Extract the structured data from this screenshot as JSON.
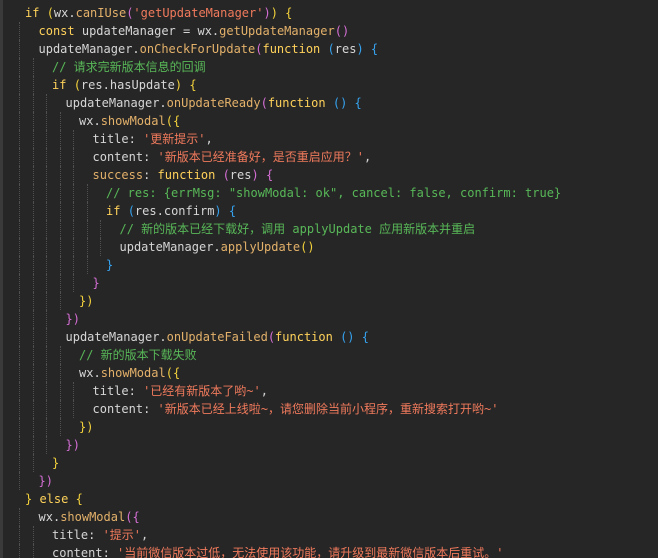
{
  "editor": {
    "language": "javascript",
    "lines": [
      [
        {
          "t": "if ",
          "c": "kw"
        },
        {
          "t": "(",
          "c": "p1"
        },
        {
          "t": "wx",
          "c": "id"
        },
        {
          "t": ".",
          "c": "op"
        },
        {
          "t": "canIUse",
          "c": "fn"
        },
        {
          "t": "(",
          "c": "p2"
        },
        {
          "t": "'getUpdateManager'",
          "c": "str"
        },
        {
          "t": ")",
          "c": "p2"
        },
        {
          "t": ")",
          "c": "p1"
        },
        {
          "t": " {",
          "c": "p1"
        }
      ],
      [
        {
          "t": "const ",
          "c": "kw"
        },
        {
          "t": "updateManager ",
          "c": "id"
        },
        {
          "t": "= ",
          "c": "op"
        },
        {
          "t": "wx",
          "c": "id"
        },
        {
          "t": ".",
          "c": "op"
        },
        {
          "t": "getUpdateManager",
          "c": "fn"
        },
        {
          "t": "()",
          "c": "p2"
        }
      ],
      [
        {
          "t": "updateManager",
          "c": "id"
        },
        {
          "t": ".",
          "c": "op"
        },
        {
          "t": "onCheckForUpdate",
          "c": "fn"
        },
        {
          "t": "(",
          "c": "p2"
        },
        {
          "t": "function ",
          "c": "kw"
        },
        {
          "t": "(",
          "c": "p3"
        },
        {
          "t": "res",
          "c": "id"
        },
        {
          "t": ")",
          "c": "p3"
        },
        {
          "t": " {",
          "c": "p3"
        }
      ],
      [
        {
          "t": "// 请求完新版本信息的回调",
          "c": "cm"
        }
      ],
      [
        {
          "t": "if ",
          "c": "kw"
        },
        {
          "t": "(",
          "c": "p1"
        },
        {
          "t": "res",
          "c": "id"
        },
        {
          "t": ".",
          "c": "op"
        },
        {
          "t": "hasUpdate",
          "c": "pr"
        },
        {
          "t": ")",
          "c": "p1"
        },
        {
          "t": " {",
          "c": "p1"
        }
      ],
      [
        {
          "t": "updateManager",
          "c": "id"
        },
        {
          "t": ".",
          "c": "op"
        },
        {
          "t": "onUpdateReady",
          "c": "fn"
        },
        {
          "t": "(",
          "c": "p2"
        },
        {
          "t": "function ",
          "c": "kw"
        },
        {
          "t": "()",
          "c": "p3"
        },
        {
          "t": " {",
          "c": "p3"
        }
      ],
      [
        {
          "t": "wx",
          "c": "id"
        },
        {
          "t": ".",
          "c": "op"
        },
        {
          "t": "showModal",
          "c": "fn"
        },
        {
          "t": "({",
          "c": "p1"
        }
      ],
      [
        {
          "t": "title",
          "c": "pr"
        },
        {
          "t": ": ",
          "c": "op"
        },
        {
          "t": "'更新提示'",
          "c": "str"
        },
        {
          "t": ",",
          "c": "op"
        }
      ],
      [
        {
          "t": "content",
          "c": "pr"
        },
        {
          "t": ": ",
          "c": "op"
        },
        {
          "t": "'新版本已经准备好，是否重启应用？'",
          "c": "str"
        },
        {
          "t": ",",
          "c": "op"
        }
      ],
      [
        {
          "t": "success",
          "c": "fn"
        },
        {
          "t": ": ",
          "c": "op"
        },
        {
          "t": "function ",
          "c": "kw"
        },
        {
          "t": "(",
          "c": "p2"
        },
        {
          "t": "res",
          "c": "id"
        },
        {
          "t": ")",
          "c": "p2"
        },
        {
          "t": " {",
          "c": "p2"
        }
      ],
      [
        {
          "t": "// res: {errMsg: \"showModal: ok\", cancel: false, confirm: true}",
          "c": "cm"
        }
      ],
      [
        {
          "t": "if ",
          "c": "kw"
        },
        {
          "t": "(",
          "c": "p3"
        },
        {
          "t": "res",
          "c": "id"
        },
        {
          "t": ".",
          "c": "op"
        },
        {
          "t": "confirm",
          "c": "pr"
        },
        {
          "t": ")",
          "c": "p3"
        },
        {
          "t": " {",
          "c": "p3"
        }
      ],
      [
        {
          "t": "// 新的版本已经下载好，调用 applyUpdate 应用新版本并重启",
          "c": "cm"
        }
      ],
      [
        {
          "t": "updateManager",
          "c": "id"
        },
        {
          "t": ".",
          "c": "op"
        },
        {
          "t": "applyUpdate",
          "c": "fn"
        },
        {
          "t": "()",
          "c": "p1"
        }
      ],
      [
        {
          "t": "}",
          "c": "p3"
        }
      ],
      [
        {
          "t": "}",
          "c": "p2"
        }
      ],
      [
        {
          "t": "})",
          "c": "p1"
        }
      ],
      [
        {
          "t": "})",
          "c": "p2"
        }
      ],
      [
        {
          "t": "updateManager",
          "c": "id"
        },
        {
          "t": ".",
          "c": "op"
        },
        {
          "t": "onUpdateFailed",
          "c": "fn"
        },
        {
          "t": "(",
          "c": "p2"
        },
        {
          "t": "function ",
          "c": "kw"
        },
        {
          "t": "()",
          "c": "p3"
        },
        {
          "t": " {",
          "c": "p3"
        }
      ],
      [
        {
          "t": "// 新的版本下载失败",
          "c": "cm"
        }
      ],
      [
        {
          "t": "wx",
          "c": "id"
        },
        {
          "t": ".",
          "c": "op"
        },
        {
          "t": "showModal",
          "c": "fn"
        },
        {
          "t": "({",
          "c": "p1"
        }
      ],
      [
        {
          "t": "title",
          "c": "pr"
        },
        {
          "t": ": ",
          "c": "op"
        },
        {
          "t": "'已经有新版本了哟~'",
          "c": "str"
        },
        {
          "t": ",",
          "c": "op"
        }
      ],
      [
        {
          "t": "content",
          "c": "pr"
        },
        {
          "t": ": ",
          "c": "op"
        },
        {
          "t": "'新版本已经上线啦~，请您删除当前小程序，重新搜索打开哟~'",
          "c": "str"
        }
      ],
      [
        {
          "t": "})",
          "c": "p1"
        }
      ],
      [
        {
          "t": "})",
          "c": "p2"
        }
      ],
      [
        {
          "t": "}",
          "c": "p1"
        }
      ],
      [
        {
          "t": "})",
          "c": "p2"
        }
      ],
      [
        {
          "t": "} ",
          "c": "p1"
        },
        {
          "t": "else",
          "c": "kw"
        },
        {
          "t": " {",
          "c": "p1"
        }
      ],
      [
        {
          "t": "wx",
          "c": "id"
        },
        {
          "t": ".",
          "c": "op"
        },
        {
          "t": "showModal",
          "c": "fn"
        },
        {
          "t": "({",
          "c": "p2"
        }
      ],
      [
        {
          "t": "title",
          "c": "pr"
        },
        {
          "t": ": ",
          "c": "op"
        },
        {
          "t": "'提示'",
          "c": "str"
        },
        {
          "t": ",",
          "c": "op"
        }
      ],
      [
        {
          "t": "content",
          "c": "pr"
        },
        {
          "t": ": ",
          "c": "op"
        },
        {
          "t": "'当前微信版本过低，无法使用该功能，请升级到最新微信版本后重试。'",
          "c": "str"
        }
      ]
    ]
  }
}
